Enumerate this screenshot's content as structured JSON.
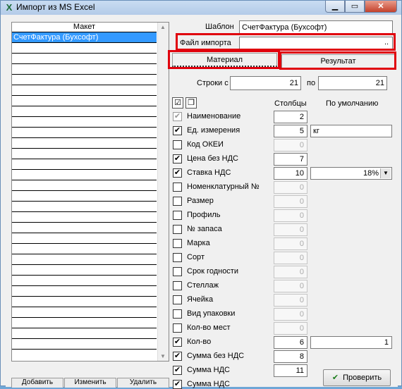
{
  "window": {
    "title": "Импорт из MS Excel",
    "app_icon": "excel-icon",
    "min_glyph": "▁",
    "max_glyph": "▭",
    "close_glyph": "✕"
  },
  "left": {
    "header": "Макет",
    "items": [
      "СчетФактура (Бухсофт)",
      "",
      "",
      "",
      "",
      "",
      "",
      "",
      "",
      "",
      "",
      "",
      "",
      "",
      "",
      "",
      "",
      "",
      "",
      "",
      "",
      "",
      "",
      "",
      "",
      "",
      "",
      "",
      "",
      ""
    ],
    "scroll_up": "▲",
    "scroll_down": "▼",
    "bottom_buttons": [
      "Добавить",
      "Изменить",
      "Удалить"
    ]
  },
  "form": {
    "template_label": "Шаблон",
    "template_value": "СчетФактура (Бухсофт)",
    "import_file_label": "Файл импорта",
    "import_file_value": "",
    "browse_label": "..",
    "tab_material": "Материал",
    "tab_result": "Результат",
    "rows_from_label": "Строки с",
    "rows_from_value": "21",
    "rows_to_label": "по",
    "rows_to_value": "21",
    "columns_header": "Столбцы",
    "default_header": "По умолчанию",
    "check_all_glyph": "☑",
    "copy_glyph": "❐",
    "fields": [
      {
        "name": "Наименование",
        "checked": true,
        "gray": true,
        "col": "2",
        "enabled": true,
        "default": null
      },
      {
        "name": "Ед. измерения",
        "checked": true,
        "gray": false,
        "col": "5",
        "enabled": true,
        "default": "кг"
      },
      {
        "name": "Код ОКЕИ",
        "checked": false,
        "gray": false,
        "col": "0",
        "enabled": false,
        "default": null
      },
      {
        "name": "Цена без НДС",
        "checked": true,
        "gray": false,
        "col": "7",
        "enabled": true,
        "default": null
      },
      {
        "name": "Ставка НДС",
        "checked": true,
        "gray": false,
        "col": "10",
        "enabled": true,
        "default": "18%",
        "combo": true
      },
      {
        "name": "Номенклатурный №",
        "checked": false,
        "gray": false,
        "col": "0",
        "enabled": false,
        "default": null
      },
      {
        "name": "Размер",
        "checked": false,
        "gray": false,
        "col": "0",
        "enabled": false,
        "default": null
      },
      {
        "name": "Профиль",
        "checked": false,
        "gray": false,
        "col": "0",
        "enabled": false,
        "default": null
      },
      {
        "name": "№ запаса",
        "checked": false,
        "gray": false,
        "col": "0",
        "enabled": false,
        "default": null
      },
      {
        "name": "Марка",
        "checked": false,
        "gray": false,
        "col": "0",
        "enabled": false,
        "default": null
      },
      {
        "name": "Сорт",
        "checked": false,
        "gray": false,
        "col": "0",
        "enabled": false,
        "default": null
      },
      {
        "name": "Срок годности",
        "checked": false,
        "gray": false,
        "col": "0",
        "enabled": false,
        "default": null
      },
      {
        "name": "Стеллаж",
        "checked": false,
        "gray": false,
        "col": "0",
        "enabled": false,
        "default": null
      },
      {
        "name": "Ячейка",
        "checked": false,
        "gray": false,
        "col": "0",
        "enabled": false,
        "default": null
      },
      {
        "name": "Вид упаковки",
        "checked": false,
        "gray": false,
        "col": "0",
        "enabled": false,
        "default": null
      },
      {
        "name": "Кол-во мест",
        "checked": false,
        "gray": false,
        "col": "0",
        "enabled": false,
        "default": null
      },
      {
        "name": "Кол-во",
        "checked": true,
        "gray": false,
        "col": "6",
        "enabled": true,
        "default": "1",
        "right": true
      },
      {
        "name": "Сумма без НДС",
        "checked": true,
        "gray": false,
        "col": "8",
        "enabled": true,
        "default": null
      },
      {
        "name": "Сумма НДС",
        "checked": true,
        "gray": false,
        "col": "11",
        "enabled": true,
        "default": null
      },
      {
        "name": "Сумма НДС",
        "checked": true,
        "gray": false,
        "col": "",
        "enabled": true,
        "default": null
      }
    ],
    "check_button": "Проверить",
    "check_glyph": "✔",
    "combo_arrow": "▼"
  },
  "colors": {
    "highlight": "#e0000d",
    "selection": "#3399ff"
  }
}
